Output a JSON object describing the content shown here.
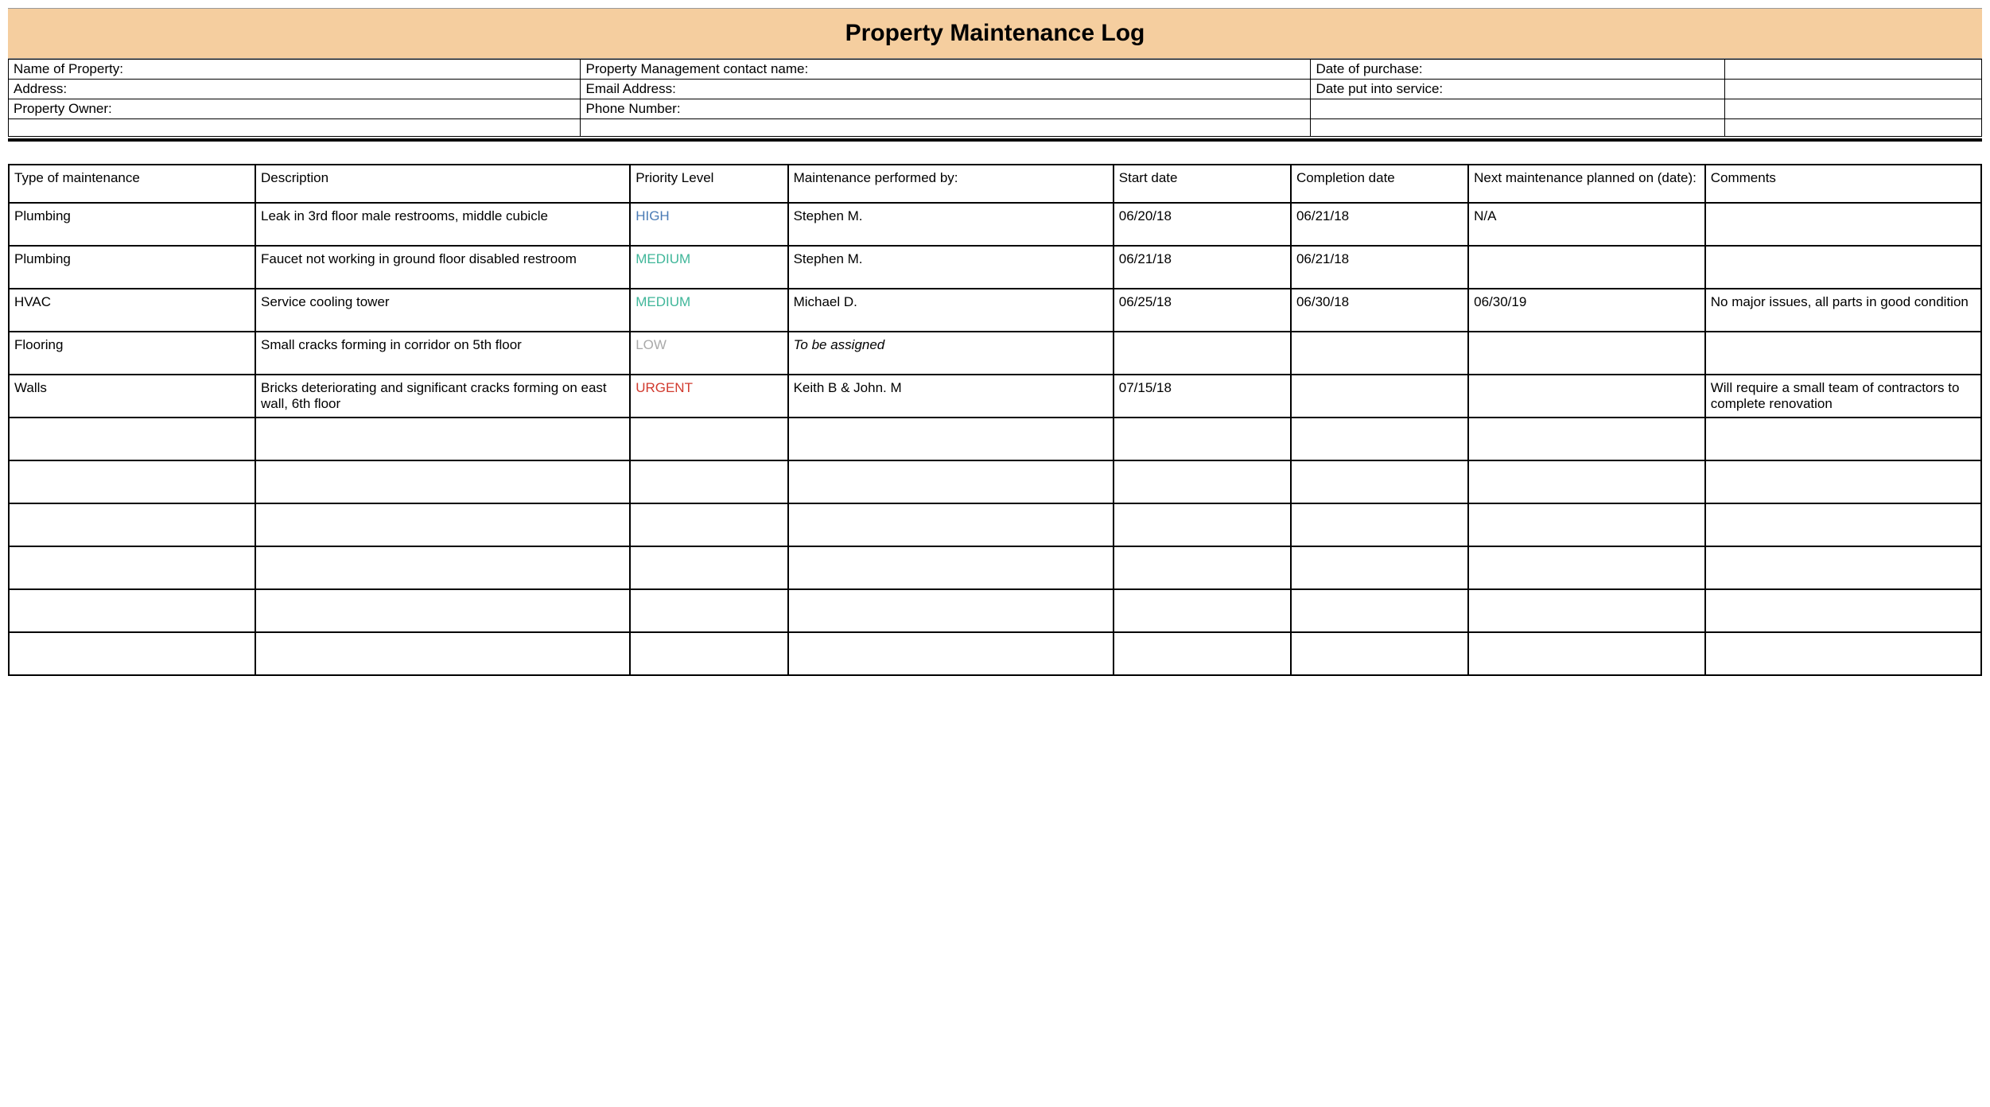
{
  "title": "Property Maintenance Log",
  "info": {
    "rows": [
      [
        "Name of Property:",
        "Property Management contact name:",
        "Date of purchase:",
        ""
      ],
      [
        "Address:",
        "Email Address:",
        "Date put into service:",
        ""
      ],
      [
        "Property Owner:",
        "Phone Number:",
        "",
        ""
      ],
      [
        "",
        "",
        "",
        ""
      ]
    ]
  },
  "log": {
    "headers": [
      "Type of maintenance",
      "Description",
      "Priority Level",
      "Maintenance performed by:",
      "Start date",
      "Completion date",
      "Next maintenance planned on (date):",
      "Comments"
    ],
    "rows": [
      {
        "type": "Plumbing",
        "description": "Leak in 3rd floor male restrooms, middle cubicle",
        "priority": "HIGH",
        "performed_by": "Stephen M.",
        "start": "06/20/18",
        "completion": "06/21/18",
        "next": "N/A",
        "comments": ""
      },
      {
        "type": "Plumbing",
        "description": "Faucet not working in ground floor disabled restroom",
        "priority": "MEDIUM",
        "performed_by": "Stephen M.",
        "start": "06/21/18",
        "completion": "06/21/18",
        "next": "",
        "comments": ""
      },
      {
        "type": "HVAC",
        "description": "Service cooling tower",
        "priority": "MEDIUM",
        "performed_by": "Michael D.",
        "start": "06/25/18",
        "completion": "06/30/18",
        "next": "06/30/19",
        "comments": "No major issues, all parts in good condition"
      },
      {
        "type": "Flooring",
        "description": "Small cracks forming in corridor on 5th floor",
        "priority": "LOW",
        "performed_by": "To be assigned",
        "performed_by_italic": true,
        "start": "",
        "completion": "",
        "next": "",
        "comments": ""
      },
      {
        "type": "Walls",
        "description": "Bricks deteriorating and significant cracks forming on east wall, 6th floor",
        "priority": "URGENT",
        "performed_by": "Keith B & John. M",
        "start": "07/15/18",
        "completion": "",
        "next": "",
        "comments": "Will require a small team of contractors to complete renovation"
      },
      {
        "type": "",
        "description": "",
        "priority": "",
        "performed_by": "",
        "start": "",
        "completion": "",
        "next": "",
        "comments": ""
      },
      {
        "type": "",
        "description": "",
        "priority": "",
        "performed_by": "",
        "start": "",
        "completion": "",
        "next": "",
        "comments": ""
      },
      {
        "type": "",
        "description": "",
        "priority": "",
        "performed_by": "",
        "start": "",
        "completion": "",
        "next": "",
        "comments": ""
      },
      {
        "type": "",
        "description": "",
        "priority": "",
        "performed_by": "",
        "start": "",
        "completion": "",
        "next": "",
        "comments": ""
      },
      {
        "type": "",
        "description": "",
        "priority": "",
        "performed_by": "",
        "start": "",
        "completion": "",
        "next": "",
        "comments": ""
      },
      {
        "type": "",
        "description": "",
        "priority": "",
        "performed_by": "",
        "start": "",
        "completion": "",
        "next": "",
        "comments": ""
      }
    ]
  },
  "colors": {
    "title_bg": "#f5ce9f",
    "HIGH": "#4a7bb5",
    "MEDIUM": "#3fb699",
    "LOW": "#a9a9a9",
    "URGENT": "#d13a2e"
  }
}
